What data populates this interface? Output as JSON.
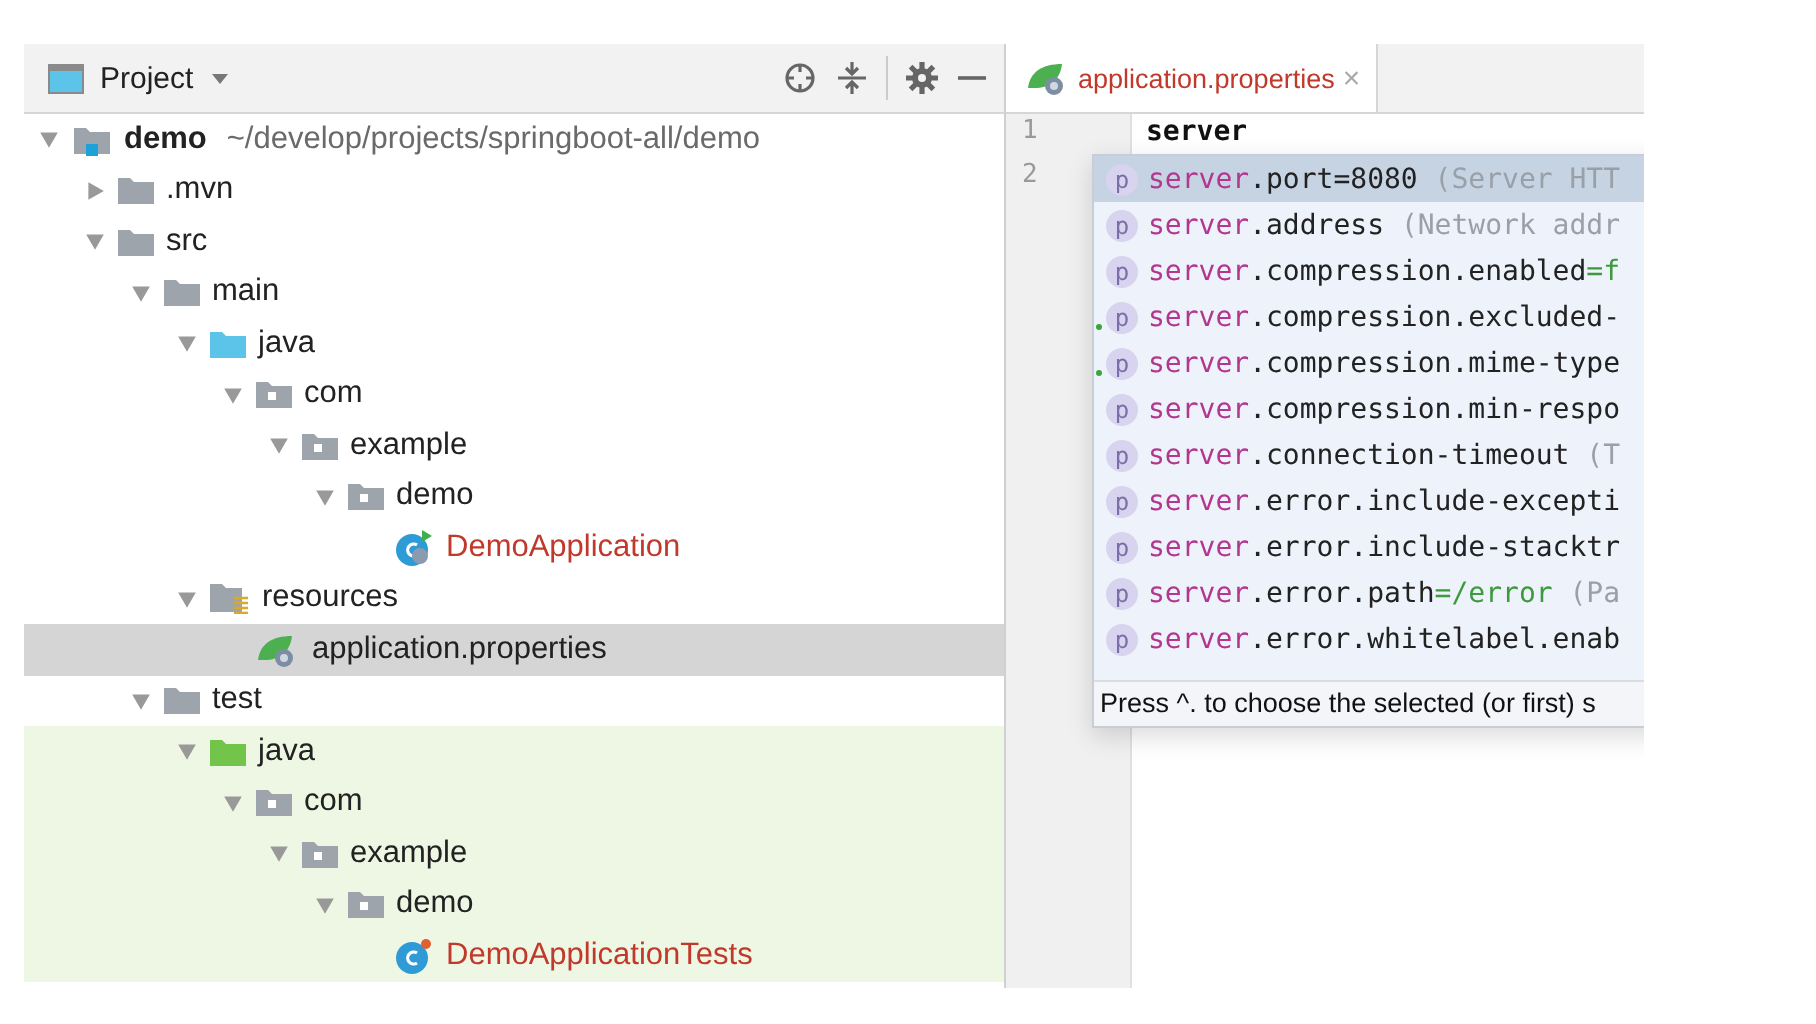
{
  "project_panel": {
    "title": "Project",
    "tree": [
      {
        "kind": "module",
        "label": "demo",
        "detail": "~/develop/projects/springboot-all/demo",
        "expanded": true,
        "selected": false,
        "test_scope": false,
        "children": [
          {
            "kind": "folder",
            "label": ".mvn",
            "expanded": false,
            "selected": false,
            "test_scope": false
          },
          {
            "kind": "folder",
            "label": "src",
            "expanded": true,
            "selected": false,
            "test_scope": false,
            "children": [
              {
                "kind": "folder",
                "label": "main",
                "expanded": true,
                "selected": false,
                "test_scope": false,
                "children": [
                  {
                    "kind": "source-folder",
                    "label": "java",
                    "expanded": true,
                    "selected": false,
                    "test_scope": false,
                    "children": [
                      {
                        "kind": "package",
                        "label": "com",
                        "expanded": true,
                        "selected": false,
                        "test_scope": false,
                        "children": [
                          {
                            "kind": "package",
                            "label": "example",
                            "expanded": true,
                            "selected": false,
                            "test_scope": false,
                            "children": [
                              {
                                "kind": "package",
                                "label": "demo",
                                "expanded": true,
                                "selected": false,
                                "test_scope": false,
                                "children": [
                                  {
                                    "kind": "spring-class",
                                    "label": "DemoApplication",
                                    "selected": false,
                                    "test_scope": false
                                  }
                                ]
                              }
                            ]
                          }
                        ]
                      }
                    ]
                  },
                  {
                    "kind": "resources",
                    "label": "resources",
                    "expanded": true,
                    "selected": false,
                    "test_scope": false,
                    "children": [
                      {
                        "kind": "spring-config",
                        "label": "application.properties",
                        "selected": true,
                        "test_scope": false
                      }
                    ]
                  }
                ]
              },
              {
                "kind": "folder",
                "label": "test",
                "expanded": true,
                "selected": false,
                "test_scope": false,
                "children": [
                  {
                    "kind": "test-folder",
                    "label": "java",
                    "expanded": true,
                    "selected": false,
                    "test_scope": true,
                    "children": [
                      {
                        "kind": "package",
                        "label": "com",
                        "expanded": true,
                        "selected": false,
                        "test_scope": true,
                        "children": [
                          {
                            "kind": "package",
                            "label": "example",
                            "expanded": true,
                            "selected": false,
                            "test_scope": true,
                            "children": [
                              {
                                "kind": "package",
                                "label": "demo",
                                "expanded": true,
                                "selected": false,
                                "test_scope": true,
                                "children": [
                                  {
                                    "kind": "test-class",
                                    "label": "DemoApplicationTests",
                                    "selected": false,
                                    "test_scope": true
                                  }
                                ]
                              }
                            ]
                          }
                        ]
                      }
                    ]
                  }
                ]
              }
            ]
          }
        ]
      }
    ]
  },
  "editor": {
    "tabs": [
      {
        "label": "application.properties",
        "close": "×",
        "selected": true
      }
    ],
    "lines": [
      {
        "number": "1",
        "text": "server"
      },
      {
        "number": "2"
      }
    ],
    "completion": {
      "items": [
        {
          "badge": "p",
          "prefix": "server",
          "name": ".port=8080",
          "value": "",
          "hint": " (Server HTT",
          "selected": true,
          "dot": false
        },
        {
          "badge": "p",
          "prefix": "server",
          "name": ".address",
          "value": "",
          "hint": " (Network addr",
          "selected": false,
          "dot": false
        },
        {
          "badge": "p",
          "prefix": "server",
          "name": ".compression.enabled",
          "value": "=f",
          "selected": false,
          "dot": false
        },
        {
          "badge": "p",
          "prefix": "server",
          "name": ".compression.excluded-",
          "value": "",
          "selected": false,
          "dot": true
        },
        {
          "badge": "p",
          "prefix": "server",
          "name": ".compression.mime-type",
          "value": "",
          "selected": false,
          "dot": true
        },
        {
          "badge": "p",
          "prefix": "server",
          "name": ".compression.min-respo",
          "value": "",
          "selected": false,
          "dot": false
        },
        {
          "badge": "p",
          "prefix": "server",
          "name": ".connection-timeout",
          "value": "",
          "hint": " (T",
          "selected": false,
          "dot": false
        },
        {
          "badge": "p",
          "prefix": "server",
          "name": ".error.include-excepti",
          "value": "",
          "selected": false,
          "dot": false
        },
        {
          "badge": "p",
          "prefix": "server",
          "name": ".error.include-stacktr",
          "value": "",
          "selected": false,
          "dot": false
        },
        {
          "badge": "p",
          "prefix": "server",
          "name": ".error.path",
          "value": "=/error",
          "hint": " (Pa",
          "selected": false,
          "dot": false
        },
        {
          "badge": "p",
          "prefix": "server",
          "name": ".error.whitelabel.enab",
          "value": "",
          "selected": false,
          "dot": false
        }
      ],
      "footer": "Press ^. to choose the selected (or first) s"
    }
  }
}
